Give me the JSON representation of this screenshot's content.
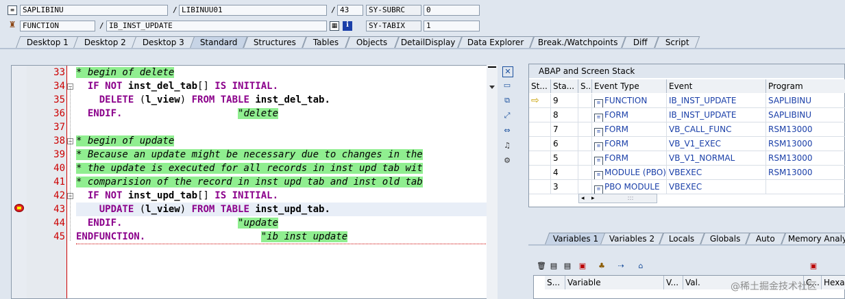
{
  "header": {
    "program": "SAPLIBINU",
    "include": "LIBINUU01",
    "line": "43",
    "subrc_label": "SY-SUBRC",
    "subrc_value": "0",
    "event_type": "FUNCTION",
    "event_name": "IB_INST_UPDATE",
    "tabix_label": "SY-TABIX",
    "tabix_value": "1",
    "slash": "/"
  },
  "tabs": [
    "Desktop 1",
    "Desktop 2",
    "Desktop 3",
    "Standard",
    "Structures",
    "Tables",
    "Objects",
    "DetailDisplay",
    "Data Explorer",
    "Break./Watchpoints",
    "Diff",
    "Script"
  ],
  "active_tab": "Standard",
  "editor": {
    "line_numbers": [
      "33",
      "34",
      "35",
      "36",
      "37",
      "38",
      "39",
      "40",
      "41",
      "42",
      "43",
      "44",
      "45"
    ],
    "lines": [
      {
        "segments": [
          {
            "t": "* begin of delete",
            "c": "cm"
          }
        ]
      },
      {
        "segments": [
          {
            "t": "  ",
            "c": ""
          },
          {
            "t": "IF NOT",
            "c": "kw"
          },
          {
            "t": " inst_del_tab",
            "c": "id"
          },
          {
            "t": "[]",
            "c": ""
          },
          {
            "t": " IS INITIAL.",
            "c": "kw"
          }
        ]
      },
      {
        "segments": [
          {
            "t": "    ",
            "c": ""
          },
          {
            "t": "DELETE",
            "c": "kw"
          },
          {
            "t": " (",
            "c": ""
          },
          {
            "t": "l_view",
            "c": "id"
          },
          {
            "t": ") ",
            "c": ""
          },
          {
            "t": "FROM TABLE",
            "c": "kw"
          },
          {
            "t": " inst_del_tab.",
            "c": "id"
          }
        ]
      },
      {
        "segments": [
          {
            "t": "  ",
            "c": ""
          },
          {
            "t": "ENDIF.",
            "c": "kw"
          },
          {
            "t": "                    ",
            "c": ""
          },
          {
            "t": "\"delete",
            "c": "cm"
          }
        ]
      },
      {
        "segments": []
      },
      {
        "segments": [
          {
            "t": "* begin of update",
            "c": "cm"
          }
        ]
      },
      {
        "segments": [
          {
            "t": "* Because an update might be necessary due to changes in the",
            "c": "cm"
          }
        ]
      },
      {
        "segments": [
          {
            "t": "* the update is executed for all records in inst upd tab wit",
            "c": "cm"
          }
        ]
      },
      {
        "segments": [
          {
            "t": "* comparision of the record in inst upd tab and inst old tab",
            "c": "cm"
          }
        ]
      },
      {
        "segments": [
          {
            "t": "  ",
            "c": ""
          },
          {
            "t": "IF NOT",
            "c": "kw"
          },
          {
            "t": " inst_upd_tab",
            "c": "id"
          },
          {
            "t": "[]",
            "c": ""
          },
          {
            "t": " IS INITIAL.",
            "c": "kw"
          }
        ]
      },
      {
        "segments": [
          {
            "t": "    ",
            "c": ""
          },
          {
            "t": "UPDATE",
            "c": "kw"
          },
          {
            "t": " (",
            "c": ""
          },
          {
            "t": "l_view",
            "c": "id"
          },
          {
            "t": ") ",
            "c": ""
          },
          {
            "t": "FROM TABLE",
            "c": "kw"
          },
          {
            "t": " inst_upd_tab.",
            "c": "id"
          }
        ]
      },
      {
        "segments": [
          {
            "t": "  ",
            "c": ""
          },
          {
            "t": "ENDIF.",
            "c": "kw"
          },
          {
            "t": "                    ",
            "c": ""
          },
          {
            "t": "\"update",
            "c": "cm"
          }
        ]
      },
      {
        "segments": [
          {
            "t": "ENDFUNCTION.",
            "c": "kw"
          },
          {
            "t": "                    ",
            "c": ""
          },
          {
            "t": "\"ib inst update",
            "c": "cm"
          }
        ]
      }
    ]
  },
  "stack": {
    "title": "ABAP and Screen Stack",
    "columns": [
      "St...",
      "Sta...",
      "S...",
      "Event Type",
      "Event",
      "Program"
    ],
    "rows": [
      {
        "level": "9",
        "type": "FUNCTION",
        "event": "IB_INST_UPDATE",
        "program": "SAPLIBINU",
        "current": true
      },
      {
        "level": "8",
        "type": "FORM",
        "event": "IB_INST_UPDATE",
        "program": "SAPLIBINU",
        "current": false
      },
      {
        "level": "7",
        "type": "FORM",
        "event": "VB_CALL_FUNC",
        "program": "RSM13000",
        "current": false
      },
      {
        "level": "6",
        "type": "FORM",
        "event": "VB_V1_EXEC",
        "program": "RSM13000",
        "current": false
      },
      {
        "level": "5",
        "type": "FORM",
        "event": "VB_V1_NORMAL",
        "program": "RSM13000",
        "current": false
      },
      {
        "level": "4",
        "type": "MODULE (PBO)",
        "event": "VBEXEC",
        "program": "RSM13000",
        "current": false
      },
      {
        "level": "3",
        "type": "PBO MODULE",
        "event": "VBEXEC",
        "program": "",
        "current": false
      }
    ],
    "scroll_grip": ":::"
  },
  "variables": {
    "tabs": [
      "Variables 1",
      "Variables 2",
      "Locals",
      "Globals",
      "Auto",
      "Memory Analy"
    ],
    "active_tab": "Variables 1",
    "columns": [
      "S...",
      "Variable",
      "V...",
      "Val.",
      "C...",
      "Hexad"
    ]
  },
  "watermark": "@稀土掘金技术社区",
  "colors": {
    "comment_bg": "#90ee90",
    "keyword": "#8b008b",
    "line_number": "#c00000",
    "background": "#dfe6ef"
  }
}
